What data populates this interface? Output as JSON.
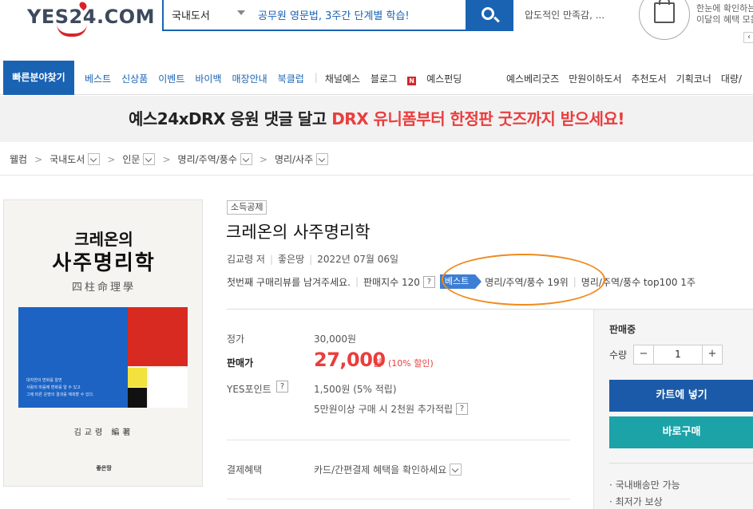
{
  "header": {
    "logo_text": "YES24.COM",
    "search_category": "국내도서",
    "search_value": "공무원 영문법, 3주간 단계별 학습!",
    "hot_keyword": "압도적인 만족감, ...",
    "promo_right_line1": "한눈에 확인하는",
    "promo_right_line2": "이달의 혜택 모음",
    "promo_arrow": "‹"
  },
  "nav": {
    "quick_label": "빠른분야찾기",
    "left_items": [
      "베스트",
      "신상품",
      "이벤트",
      "바이백",
      "매장안내",
      "북클럽"
    ],
    "mid_items": [
      "채널예스",
      "블로그"
    ],
    "funding_label": "예스펀딩",
    "funding_icon_letter": "N",
    "right_items": [
      "예스베리굿즈",
      "만원이하도서",
      "추천도서",
      "기획코너",
      "대량/"
    ]
  },
  "banner": {
    "part1": "예스24xDRX 응원 댓글 달고 ",
    "part2": "DRX 유니폼부터 한정판 굿즈까지 받으세요!"
  },
  "breadcrumb": {
    "home": "웰컴",
    "items": [
      "국내도서",
      "인문",
      "명리/주역/풍수",
      "명리/사주"
    ],
    "separator": ">"
  },
  "cover": {
    "title_small": "크레온의",
    "title_large": "사주명리학",
    "hanja": "四柱命理學",
    "blurb_lines": [
      "대자연의 변화를 알면",
      "사람의 마음에 변화를 알 수 있고",
      "그에 따른 운명의 결과를 예측할 수 있다."
    ],
    "author": "김교령 編著",
    "publisher": "좋은땅"
  },
  "product": {
    "badge": "소득공제",
    "title": "크레온의 사주명리학",
    "author": "김교령 저",
    "publisher": "좋은땅",
    "date": "2022년 07월 06일",
    "review_prompt": "첫번째 구매리뷰를 남겨주세요.",
    "sales_index": "판매지수 120",
    "help_mark": "?",
    "best_badge": "베스트",
    "best_rank": "명리/주역/풍수 19위",
    "top100": "명리/주역/풍수 top100 1주"
  },
  "price": {
    "list_label": "정가",
    "list_value": "30,000원",
    "sale_label": "판매가",
    "sale_value": "27,000",
    "sale_unit": "원",
    "discount": "(10% 할인)",
    "point_label": "YES포인트",
    "point_value": "1,500원 (5% 적립)",
    "point_extra": "5만원이상 구매 시 2천원 추가적립",
    "benefit_label": "결제혜택",
    "benefit_value": "카드/간편결제 혜택을 확인하세요"
  },
  "buybox": {
    "status": "판매중",
    "qty_label": "수량",
    "qty_value": "1",
    "minus": "−",
    "plus": "+",
    "cart_label": "카트에 넣기",
    "buy_label": "바로구매",
    "note1": "· 국내배송만 가능",
    "note2": "· 최저가 보상"
  },
  "colors": {
    "brand_blue": "#1a63b3",
    "sale_red": "#ea3d3d",
    "buy_teal": "#1ba3a8",
    "highlight_orange": "#f08a1c"
  },
  "icons": {
    "search": "search-icon",
    "cart": "shopping-bag-icon",
    "dropdown": "chevron-down-icon"
  }
}
